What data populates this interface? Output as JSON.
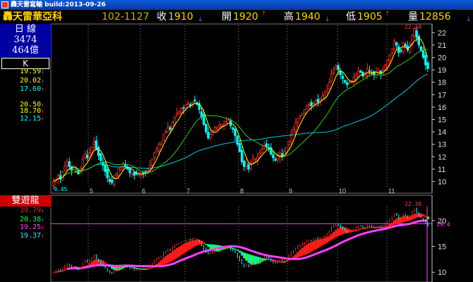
{
  "window": {
    "title": "轟天雷寫輸 build:2013-09-26"
  },
  "quote": {
    "name": "轟天雷華亞科",
    "code": "102-1127",
    "close_label": "收",
    "close": "1910",
    "open_label": "開",
    "open": "1920",
    "high_label": "高",
    "high": "1940",
    "low_label": "低",
    "low": "1905",
    "volume_label": "量",
    "volume": "12856",
    "down_arrow": "↓",
    "up_arrow": "↑"
  },
  "panel_top": {
    "period": "日  線",
    "value1": "3474",
    "value2": "464億",
    "mode": "K",
    "indicators": [
      {
        "value": "19.59",
        "arrow": "↓",
        "color": "#ffff00"
      },
      {
        "value": "20.02",
        "arrow": "↓",
        "color": "#ffff00"
      },
      {
        "value": "17.60",
        "arrow": "↑",
        "color": "#00ffff"
      },
      {
        "value": "20.50",
        "arrow": "↓",
        "color": "#ffff00"
      },
      {
        "value": "18.70",
        "arrow": "↑",
        "color": "#ffff00"
      },
      {
        "value": "12.15",
        "arrow": "↑",
        "color": "#00ffff"
      }
    ]
  },
  "panel_bottom": {
    "title": "雙遊龍",
    "indicators": [
      {
        "value": "19.79",
        "arrow": "↓",
        "color": "#ff2020"
      },
      {
        "value": "20.38",
        "arrow": "↓",
        "color": "#20ff20"
      },
      {
        "value": "19.25",
        "arrow": "↑",
        "color": "#ff40ff"
      },
      {
        "value": "19.37",
        "arrow": "↑",
        "color": "#00ffff"
      }
    ]
  },
  "chart_data": [
    {
      "type": "candlestick",
      "title": "",
      "x_months": [
        "5",
        "6",
        "7",
        "8",
        "9",
        "10",
        "11"
      ],
      "y_ticks": [
        10,
        11,
        12,
        13,
        14,
        15,
        16,
        17,
        18,
        19,
        20,
        21,
        22
      ],
      "ylim": [
        9.4,
        22.7
      ],
      "annotations": {
        "high_label": "22.30",
        "low_label": "9.45"
      },
      "close": [
        10.0,
        10.2,
        10.5,
        10.2,
        10.8,
        11.2,
        11.6,
        11.2,
        10.9,
        11.0,
        10.8,
        10.6,
        11.0,
        11.8,
        12.2,
        11.9,
        12.3,
        12.8,
        13.2,
        12.6,
        12.1,
        11.7,
        11.3,
        10.8,
        10.3,
        10.0,
        9.9,
        10.3,
        10.6,
        11.0,
        11.2,
        11.4,
        11.2,
        11.0,
        10.7,
        10.7,
        10.5,
        10.6,
        10.6,
        10.6,
        10.7,
        10.8,
        11.0,
        11.3,
        11.8,
        12.3,
        12.6,
        13.0,
        13.1,
        13.8,
        14.0,
        14.4,
        14.2,
        14.8,
        15.2,
        15.5,
        15.6,
        15.9,
        15.9,
        16.2,
        16.3,
        16.1,
        16.4,
        16.5,
        16.2,
        15.8,
        15.2,
        14.6,
        14.0,
        13.5,
        13.8,
        14.1,
        14.4,
        14.3,
        14.5,
        14.6,
        14.6,
        14.8,
        15.0,
        14.5,
        14.2,
        13.7,
        13.0,
        12.4,
        11.6,
        11.2,
        11.5,
        11.0,
        11.5,
        11.9,
        11.8,
        12.0,
        12.3,
        12.6,
        12.9,
        12.8,
        12.6,
        12.2,
        11.9,
        11.7,
        12.1,
        12.3,
        12.0,
        12.4,
        12.8,
        13.2,
        13.8,
        14.2,
        14.7,
        15.1,
        15.3,
        15.5,
        15.8,
        16.1,
        16.2,
        16.1,
        16.3,
        16.5,
        16.4,
        16.7,
        16.9,
        17.0,
        17.4,
        18.0,
        18.7,
        19.0,
        19.3,
        19.0,
        18.6,
        18.3,
        18.0,
        17.8,
        18.0,
        18.1,
        18.4,
        18.6,
        18.9,
        18.8,
        18.5,
        18.6,
        19.1,
        18.9,
        18.7,
        18.6,
        18.8,
        18.9,
        18.7,
        19.0,
        19.4,
        19.8,
        20.2,
        20.7,
        21.3,
        21.0,
        20.4,
        20.5,
        21.2,
        20.9,
        20.6,
        21.0,
        21.8,
        22.3,
        21.6,
        21.0,
        20.5,
        20.0,
        19.4,
        19.1
      ]
    },
    {
      "type": "line",
      "title": "",
      "series": [
        {
          "name": "",
          "values": []
        }
      ],
      "y_ticks": [
        10,
        15,
        20
      ],
      "ylim": [
        8.8,
        22.7
      ],
      "annotations": {
        "high_label": "22.30",
        "level_label": "19.4"
      }
    }
  ]
}
